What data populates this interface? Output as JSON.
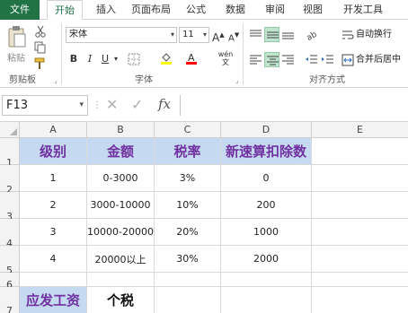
{
  "ribbon_tabs": [
    {
      "label": "文件"
    },
    {
      "label": "开始"
    },
    {
      "label": "插入"
    },
    {
      "label": "页面布局"
    },
    {
      "label": "公式"
    },
    {
      "label": "数据"
    },
    {
      "label": "审阅"
    },
    {
      "label": "视图"
    },
    {
      "label": "开发工具"
    }
  ],
  "clipboard": {
    "paste_label": "粘贴",
    "group_label": "剪贴板"
  },
  "font": {
    "name": "宋体",
    "size": "11",
    "grow": "A",
    "shrink": "A",
    "bold": "B",
    "italic": "I",
    "underline": "U",
    "phonetic": "wén",
    "group_label": "字体"
  },
  "alignment": {
    "wrap_label": "自动换行",
    "merge_label": "合并后居中",
    "group_label": "对齐方式"
  },
  "formula_bar": {
    "name_box": "F13",
    "fx": "fx",
    "content": ""
  },
  "columns": [
    "A",
    "B",
    "C",
    "D",
    "E"
  ],
  "rows": [
    "1",
    "2",
    "3",
    "4",
    "5",
    "6",
    "7"
  ],
  "table": {
    "headers": [
      "级别",
      "金额",
      "税率",
      "新速算扣除数"
    ],
    "rows": [
      [
        "1",
        "0-3000",
        "3%",
        "0"
      ],
      [
        "2",
        "3000-10000",
        "10%",
        "200"
      ],
      [
        "3",
        "10000-20000",
        "20%",
        "1000"
      ],
      [
        "4",
        "20000以上",
        "30%",
        "2000"
      ]
    ]
  },
  "row7": {
    "label": "应发工资",
    "value": "个税"
  },
  "colors": {
    "excel_green": "#217346",
    "header_fill": "#c5d9f1",
    "header_text": "#7030a0",
    "selected_align": "#bfe6cc"
  }
}
